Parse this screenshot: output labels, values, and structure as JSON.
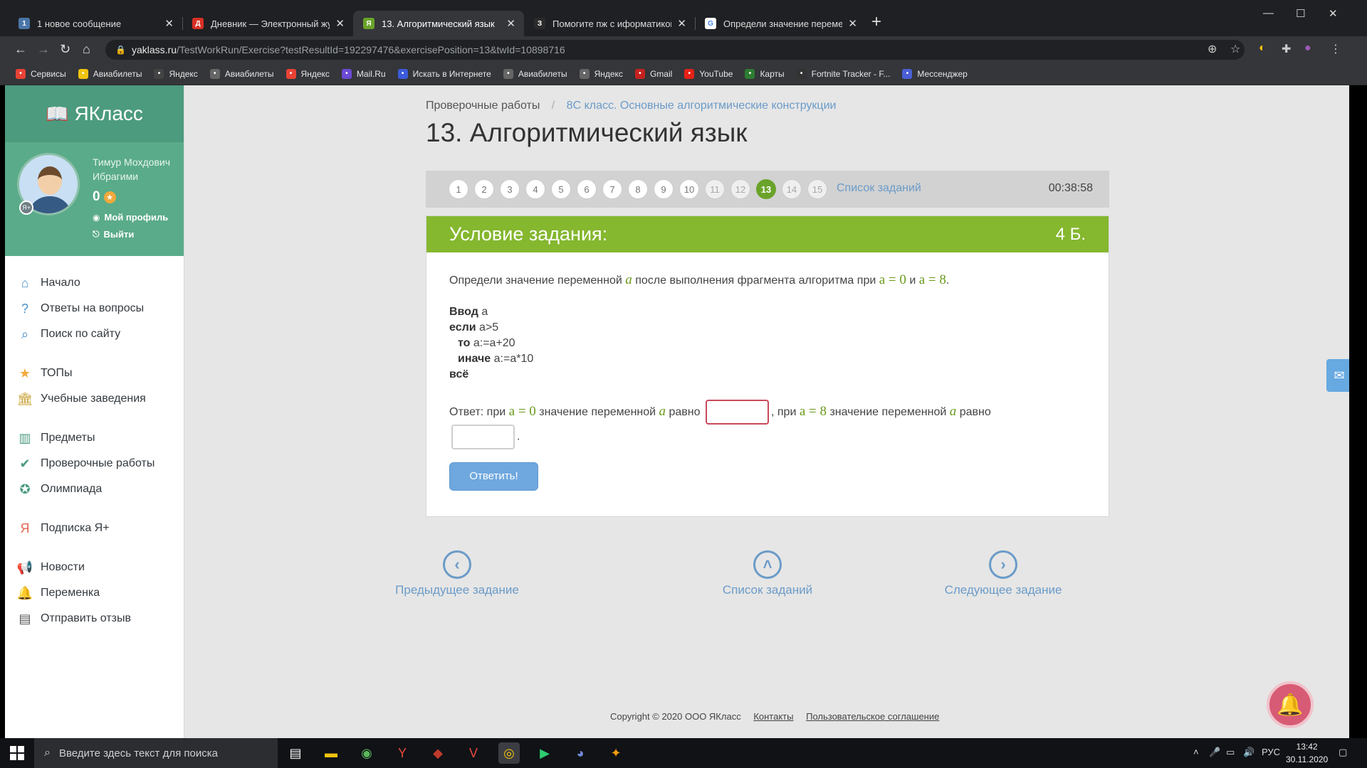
{
  "browser": {
    "tabs": [
      {
        "title": "1 новое сообщение",
        "favicon": "1",
        "color": "#4a76a8"
      },
      {
        "title": "Дневник — Электронный журн...",
        "favicon": "Д",
        "color": "#d93025"
      },
      {
        "title": "13. Алгоритмический язык",
        "favicon": "Я",
        "color": "#6aa329"
      },
      {
        "title": "Помогите пж с иформатикой - ...",
        "favicon": "З",
        "color": "#2b2b2b"
      },
      {
        "title": "Определи значение переменно...",
        "favicon": "G",
        "color": "#ffffff"
      }
    ],
    "url_host": "yaklass.ru",
    "url_path": "/TestWorkRun/Exercise?testResultId=192297476&exercisePosition=13&twId=10898716",
    "bookmarks": [
      {
        "label": "Сервисы",
        "icon": "apps-icon",
        "color": "#e94235"
      },
      {
        "label": "Авиабилеты",
        "icon": "plane-icon",
        "color": "#f1c40f"
      },
      {
        "label": "Яндекс",
        "icon": "yandex-icon",
        "color": "#444"
      },
      {
        "label": "Авиабилеты",
        "icon": "globe-icon",
        "color": "#666"
      },
      {
        "label": "Яндекс",
        "icon": "yandex-icon",
        "color": "#e94235"
      },
      {
        "label": "Mail.Ru",
        "icon": "mail-icon",
        "color": "#6c4bd6"
      },
      {
        "label": "Искать в Интернете",
        "icon": "search-icon",
        "color": "#3b5bdb"
      },
      {
        "label": "Авиабилеты",
        "icon": "globe-icon",
        "color": "#666"
      },
      {
        "label": "Яндекс",
        "icon": "globe-icon",
        "color": "#666"
      },
      {
        "label": "Gmail",
        "icon": "gmail-icon",
        "color": "#c5221f"
      },
      {
        "label": "YouTube",
        "icon": "youtube-icon",
        "color": "#e62117"
      },
      {
        "label": "Карты",
        "icon": "map-icon",
        "color": "#2e7d32"
      },
      {
        "label": "Fortnite Tracker - F...",
        "icon": "tracker-icon",
        "color": "#333"
      },
      {
        "label": "Мессенджер",
        "icon": "messenger-icon",
        "color": "#4a5fd6"
      }
    ]
  },
  "sidebar": {
    "logo": "ЯКласс",
    "user_name": "Тимур Мохдович Ибрагими",
    "points": "0",
    "profile_link": "Мой профиль",
    "logout_link": "Выйти",
    "menu_groups": [
      [
        {
          "label": "Начало",
          "icon": "home-icon"
        },
        {
          "label": "Ответы на вопросы",
          "icon": "question-icon"
        },
        {
          "label": "Поиск по сайту",
          "icon": "search-icon"
        }
      ],
      [
        {
          "label": "ТОПы",
          "icon": "star-icon"
        },
        {
          "label": "Учебные заведения",
          "icon": "school-icon"
        }
      ],
      [
        {
          "label": "Предметы",
          "icon": "book-icon"
        },
        {
          "label": "Проверочные работы",
          "icon": "check-icon"
        },
        {
          "label": "Олимпиада",
          "icon": "medal-icon"
        }
      ],
      [
        {
          "label": "Подписка Я+",
          "icon": "subscription-icon"
        }
      ],
      [
        {
          "label": "Новости",
          "icon": "megaphone-icon"
        },
        {
          "label": "Переменка",
          "icon": "bell-icon"
        },
        {
          "label": "Отправить отзыв",
          "icon": "feedback-icon"
        }
      ]
    ]
  },
  "breadcrumb": {
    "root": "Проверочные работы",
    "current": "8С класс. Основные алгоритмические конструкции"
  },
  "page_title": "13. Алгоритмический язык",
  "question_nav": {
    "numbers": [
      "1",
      "2",
      "3",
      "4",
      "5",
      "6",
      "7",
      "8",
      "9",
      "10",
      "11",
      "12",
      "13",
      "14",
      "15"
    ],
    "current": "13",
    "pending": [
      "11",
      "12",
      "14",
      "15"
    ],
    "task_list_link": "Список заданий",
    "timer": "00:38:58"
  },
  "task": {
    "header": "Условие задания:",
    "score": "4 Б.",
    "text_before": "Определи значение переменной",
    "text_var": "a",
    "text_middle": "после выполнения фрагмента алгоритма при",
    "cond1": "a = 0",
    "and_word": "и",
    "cond2": "a = 8",
    "code": [
      {
        "kw": "Ввод",
        "rest": " a",
        "indent": false
      },
      {
        "kw": "если",
        "rest": " a>5",
        "indent": false
      },
      {
        "kw": "то",
        "rest": " a:=a+20",
        "indent": true
      },
      {
        "kw": "иначе",
        "rest": " a:=a*10",
        "indent": true
      },
      {
        "kw": "всё",
        "rest": "",
        "indent": false
      }
    ],
    "answer_prefix": "Ответ: при",
    "answer_cond1": "a = 0",
    "answer_mid1": "значение переменной",
    "answer_var": "a",
    "answer_eq": "равно",
    "answer_sep": ", при",
    "answer_cond2": "a = 8",
    "submit_label": "Ответить!"
  },
  "bottom_nav": {
    "prev": "Предыдущее задание",
    "list": "Список заданий",
    "next": "Следующее задание"
  },
  "footer": {
    "copyright": "Copyright © 2020 ООО ЯКласс",
    "contacts": "Контакты",
    "agreement": "Пользовательское соглашение"
  },
  "taskbar": {
    "search_placeholder": "Введите здесь текст для поиска",
    "lang": "РУС",
    "time": "13:42",
    "date": "30.11.2020"
  }
}
